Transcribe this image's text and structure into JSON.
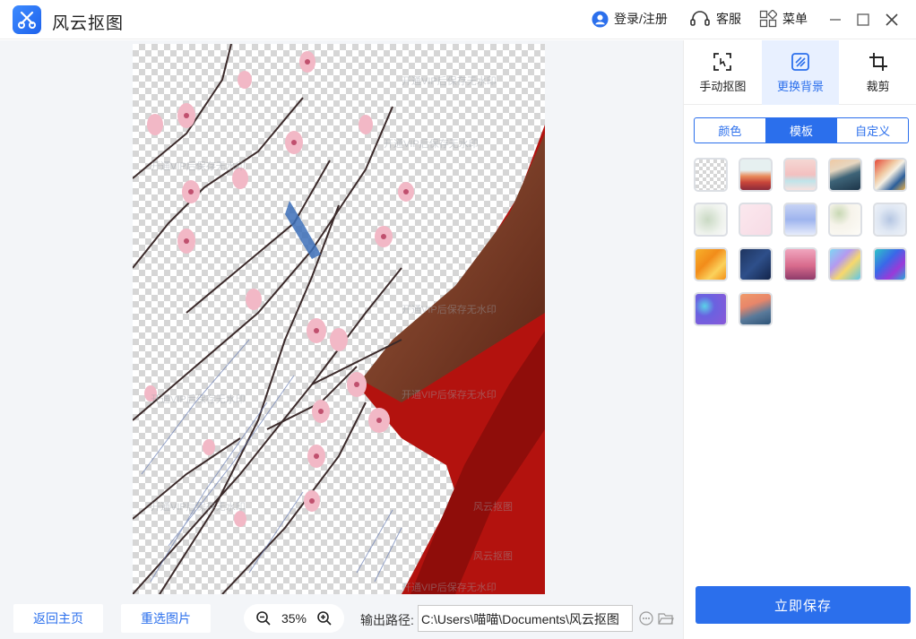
{
  "app": {
    "title": "风云抠图"
  },
  "header": {
    "login_label": "登录/注册",
    "service_label": "客服",
    "menu_label": "菜单"
  },
  "workspace": {
    "watermark_text": "开通VIP后保存无水印",
    "watermark_text_short": "风云抠图"
  },
  "bottom": {
    "home_label": "返回主页",
    "reselect_label": "重选图片",
    "zoom_value": "35%",
    "output_label": "输出路径:",
    "output_path": "C:\\Users\\喵喵\\Documents\\风云抠图"
  },
  "panel": {
    "tabs": [
      {
        "label": "手动抠图",
        "icon": "manual-cutout-icon",
        "active": false
      },
      {
        "label": "更换背景",
        "icon": "change-background-icon",
        "active": true
      },
      {
        "label": "裁剪",
        "icon": "crop-icon",
        "active": false
      }
    ],
    "segments": [
      {
        "label": "颜色",
        "active": false
      },
      {
        "label": "模板",
        "active": true
      },
      {
        "label": "自定义",
        "active": false
      }
    ],
    "save_label": "立即保存"
  },
  "colors": {
    "accent": "#2b6fec",
    "accent_light": "#e8f0ff",
    "workspace_bg": "#f3f5f8"
  }
}
